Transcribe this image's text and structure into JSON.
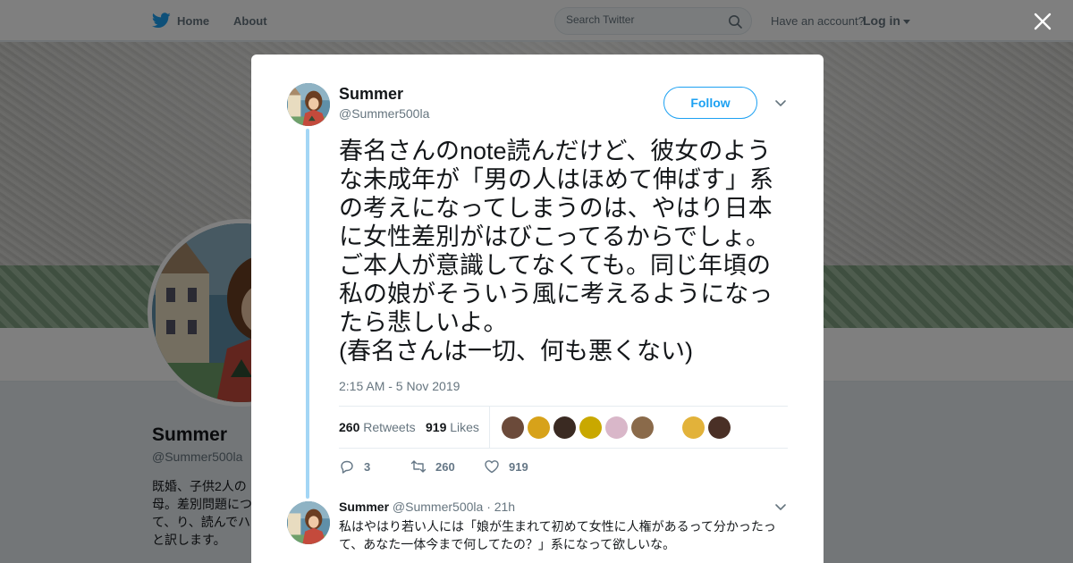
{
  "nav": {
    "home": "Home",
    "about": "About",
    "search_placeholder": "Search Twitter",
    "have_account": "Have an account?",
    "login": "Log in"
  },
  "profile": {
    "name": "Summer",
    "handle": "@Summer500la",
    "bio": "既婚、子供2人の母。差別問題について、り、読んでハッと訳します。"
  },
  "tweet": {
    "author": "Summer",
    "handle": "@Summer500la",
    "follow": "Follow",
    "text": "春名さんのnote読んだけど、彼女のような未成年が「男の人はほめて伸ばす」系の考えになってしまうのは、やはり日本に女性差別がはびこってるからでしょ。ご本人が意識してなくても。同じ年頃の私の娘がそういう風に考えるようになったら悲しいよ。\n(春名さんは一切、何も悪くない)",
    "time": "2:15 AM - 5 Nov 2019",
    "retweets_count": "260",
    "retweets_label": "Retweets",
    "likes_count": "919",
    "likes_label": "Likes",
    "replies_action": "3",
    "retweets_action": "260",
    "likes_action": "919"
  },
  "likers": [
    {
      "color": "#6b4a3a"
    },
    {
      "color": "#d7a21a"
    },
    {
      "color": "#3a2a22"
    },
    {
      "color": "#c9a800"
    },
    {
      "color": "#d9b7c9"
    },
    {
      "color": "#8a6a4a"
    },
    {
      "color": "#e2b23a"
    },
    {
      "color": "#4a3026"
    }
  ],
  "reply": {
    "author": "Summer",
    "handle": "@Summer500la",
    "time": "· 21h",
    "text": "私はやはり若い人には「娘が生まれて初めて女性に人権があるって分かったって、あなた一体今まで何してたの？」系になって欲しいな。"
  },
  "colors": {
    "accent": "#1da1f2",
    "thread_line": "#a3d6f5",
    "muted": "#66757f"
  }
}
